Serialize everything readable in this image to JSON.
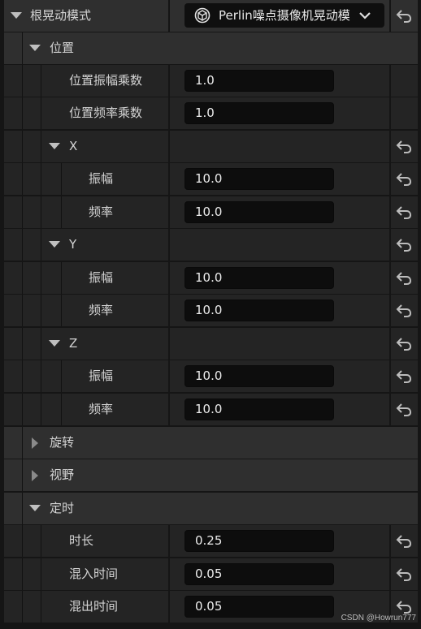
{
  "root": {
    "label": "根晃动模式",
    "dropdown_value": "Perlin噪点摄像机晃动模"
  },
  "sections": {
    "position": {
      "label": "位置",
      "amplitude_multiplier_label": "位置振幅乘数",
      "amplitude_multiplier_value": "1.0",
      "frequency_multiplier_label": "位置频率乘数",
      "frequency_multiplier_value": "1.0",
      "x": {
        "label": "X",
        "amplitude_label": "振幅",
        "amplitude_value": "10.0",
        "frequency_label": "频率",
        "frequency_value": "10.0"
      },
      "y": {
        "label": "Y",
        "amplitude_label": "振幅",
        "amplitude_value": "10.0",
        "frequency_label": "频率",
        "frequency_value": "10.0"
      },
      "z": {
        "label": "Z",
        "amplitude_label": "振幅",
        "amplitude_value": "10.0",
        "frequency_label": "频率",
        "frequency_value": "10.0"
      }
    },
    "rotation": {
      "label": "旋转"
    },
    "fov": {
      "label": "视野"
    },
    "timing": {
      "label": "定时",
      "duration_label": "时长",
      "duration_value": "0.25",
      "blend_in_label": "混入时间",
      "blend_in_value": "0.05",
      "blend_out_label": "混出时间",
      "blend_out_value": "0.05"
    }
  },
  "watermark": "CSDN @Howrun777",
  "colors": {
    "background": "#151515",
    "row": "#242424",
    "category_row": "#2f2f2f",
    "input": "#0d0d0d",
    "text": "#d4d4d4"
  },
  "icons": {
    "reset": "reset-arrow-icon",
    "expanded": "caret-down-icon",
    "collapsed": "caret-right-icon",
    "class": "unreal-class-icon",
    "dropdown": "chevron-down-icon"
  }
}
